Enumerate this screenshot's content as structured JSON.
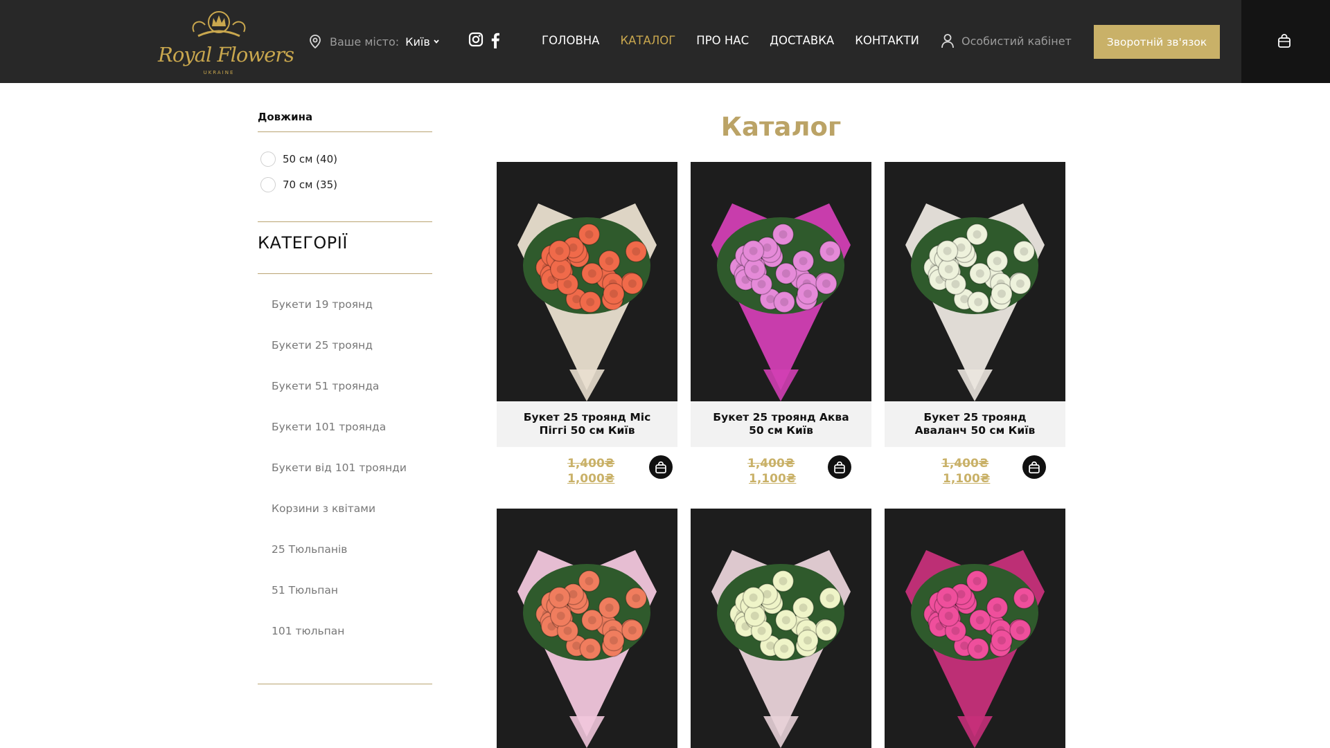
{
  "header": {
    "logo": {
      "main": "Royal Flowers",
      "sub": "UKRAINE"
    },
    "city_label": "Ваше місто:",
    "city_value": "Київ",
    "nav": [
      "ГОЛОВНА",
      "КАТАЛОГ",
      "ПРО НАС",
      "ДОСТАВКА",
      "КОНТАКТИ"
    ],
    "active_nav": "КАТАЛОГ",
    "account_label": "Особистий кабінет",
    "cta_label": "Зворотній зв'язок",
    "icons": [
      "location-pin-icon",
      "instagram-icon",
      "facebook-icon",
      "user-icon",
      "shopping-bag-icon"
    ]
  },
  "sidebar": {
    "filter_title": "Довжина",
    "length_options": [
      {
        "label": "50 см (40)"
      },
      {
        "label": "70 см (35)"
      }
    ],
    "categories_title": "КАТЕГОРІЇ",
    "categories": [
      "Букети 19 троянд",
      "Букети 25 троянд",
      "Букети 51 троянда",
      "Букети 101 троянда",
      "Букети від 101 троянди",
      "Корзини з квітами",
      "25 Тюльпанів",
      "51 Тюльпан",
      "101 тюльпан"
    ]
  },
  "catalog": {
    "title": "Каталог",
    "products": [
      {
        "name": "Букет 25 троянд Міс Піггі 50 см Київ",
        "old_price": "1,400₴",
        "new_price": "1,000₴",
        "flower_color": "#f06a4a",
        "wrap_color": "#e9dfcf"
      },
      {
        "name": "Букет 25 троянд Аква 50 см Київ",
        "old_price": "1,400₴",
        "new_price": "1,100₴",
        "flower_color": "#e58ad8",
        "wrap_color": "#d23fb4"
      },
      {
        "name": "Букет 25 троянд Аваланч 50 см Київ",
        "old_price": "1,400₴",
        "new_price": "1,100₴",
        "flower_color": "#eef2dc",
        "wrap_color": "#ebe6df"
      },
      {
        "name": "",
        "flower_color": "#f07d5e",
        "wrap_color": "#f1c6dc"
      },
      {
        "name": "",
        "flower_color": "#eff4c8",
        "wrap_color": "#e8d2d8"
      },
      {
        "name": "",
        "flower_color": "#ef4f9c",
        "wrap_color": "#c6307a"
      }
    ]
  },
  "colors": {
    "header_bg": "#282828",
    "accent_gold": "#c9a74e",
    "button_gold": "#c9b168",
    "price_gold": "#c9b168"
  }
}
